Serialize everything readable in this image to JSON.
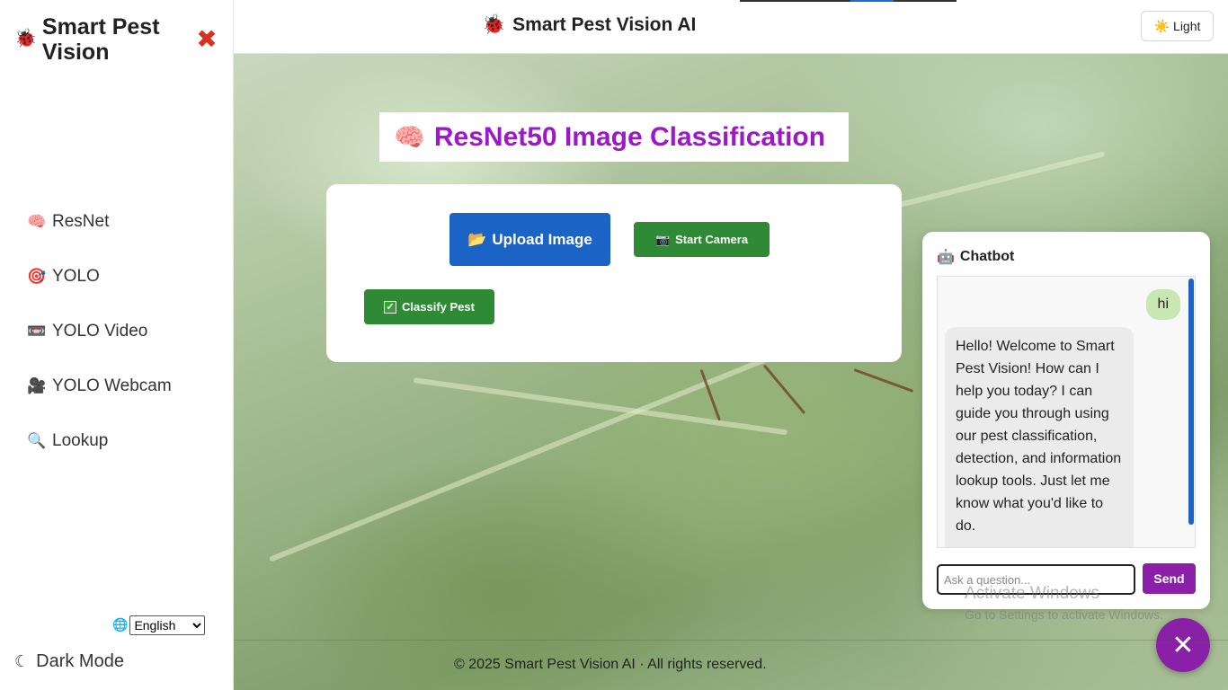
{
  "sidebar": {
    "brand_icon": "bug-icon",
    "brand_title": "Smart Pest Vision",
    "close_symbol": "✖",
    "items": [
      {
        "icon": "🧠",
        "icon_name": "brain-icon",
        "label": "ResNet"
      },
      {
        "icon": "🎯",
        "icon_name": "target-icon",
        "label": "YOLO"
      },
      {
        "icon": "📼",
        "icon_name": "videotape-icon",
        "label": "YOLO Video"
      },
      {
        "icon": "🎥",
        "icon_name": "camera-icon",
        "label": "YOLO Webcam"
      },
      {
        "icon": "🔍",
        "icon_name": "magnifier-icon",
        "label": "Lookup"
      }
    ],
    "language": {
      "icon": "🌐",
      "selected": "English"
    },
    "dark_mode_label": "Dark Mode"
  },
  "header": {
    "icon": "🐞",
    "title": "Smart Pest Vision AI",
    "theme_button": {
      "icon": "☀️",
      "label": "Light"
    }
  },
  "main": {
    "title_icon": "🧠",
    "title": "ResNet50 Image Classification",
    "upload_button": {
      "icon": "📂",
      "label": "Upload Image"
    },
    "camera_button": {
      "icon": "📷",
      "label": "Start Camera"
    },
    "classify_button": {
      "icon": "✓",
      "label": "Classify Pest"
    }
  },
  "chatbot": {
    "icon": "🤖",
    "title": "Chatbot",
    "messages": [
      {
        "from": "user",
        "text": "hi"
      },
      {
        "from": "bot",
        "text": "Hello! Welcome to Smart Pest Vision! How can I help you today? I can guide you through using our pest classification, detection, and information lookup tools. Just let me know what you'd like to do."
      }
    ],
    "input_placeholder": "Ask a question...",
    "send_label": "Send"
  },
  "watermark": {
    "line1": "Activate Windows",
    "line2": "Go to Settings to activate Windows."
  },
  "fab_symbol": "✕",
  "footer": "© 2025 Smart Pest Vision AI · All rights reserved.",
  "colors": {
    "brand_purple": "#9c19c8",
    "upload_blue": "#1c63c6",
    "action_green": "#2e8a35",
    "send_purple": "#8a1fa8",
    "close_red": "#d8321e"
  }
}
